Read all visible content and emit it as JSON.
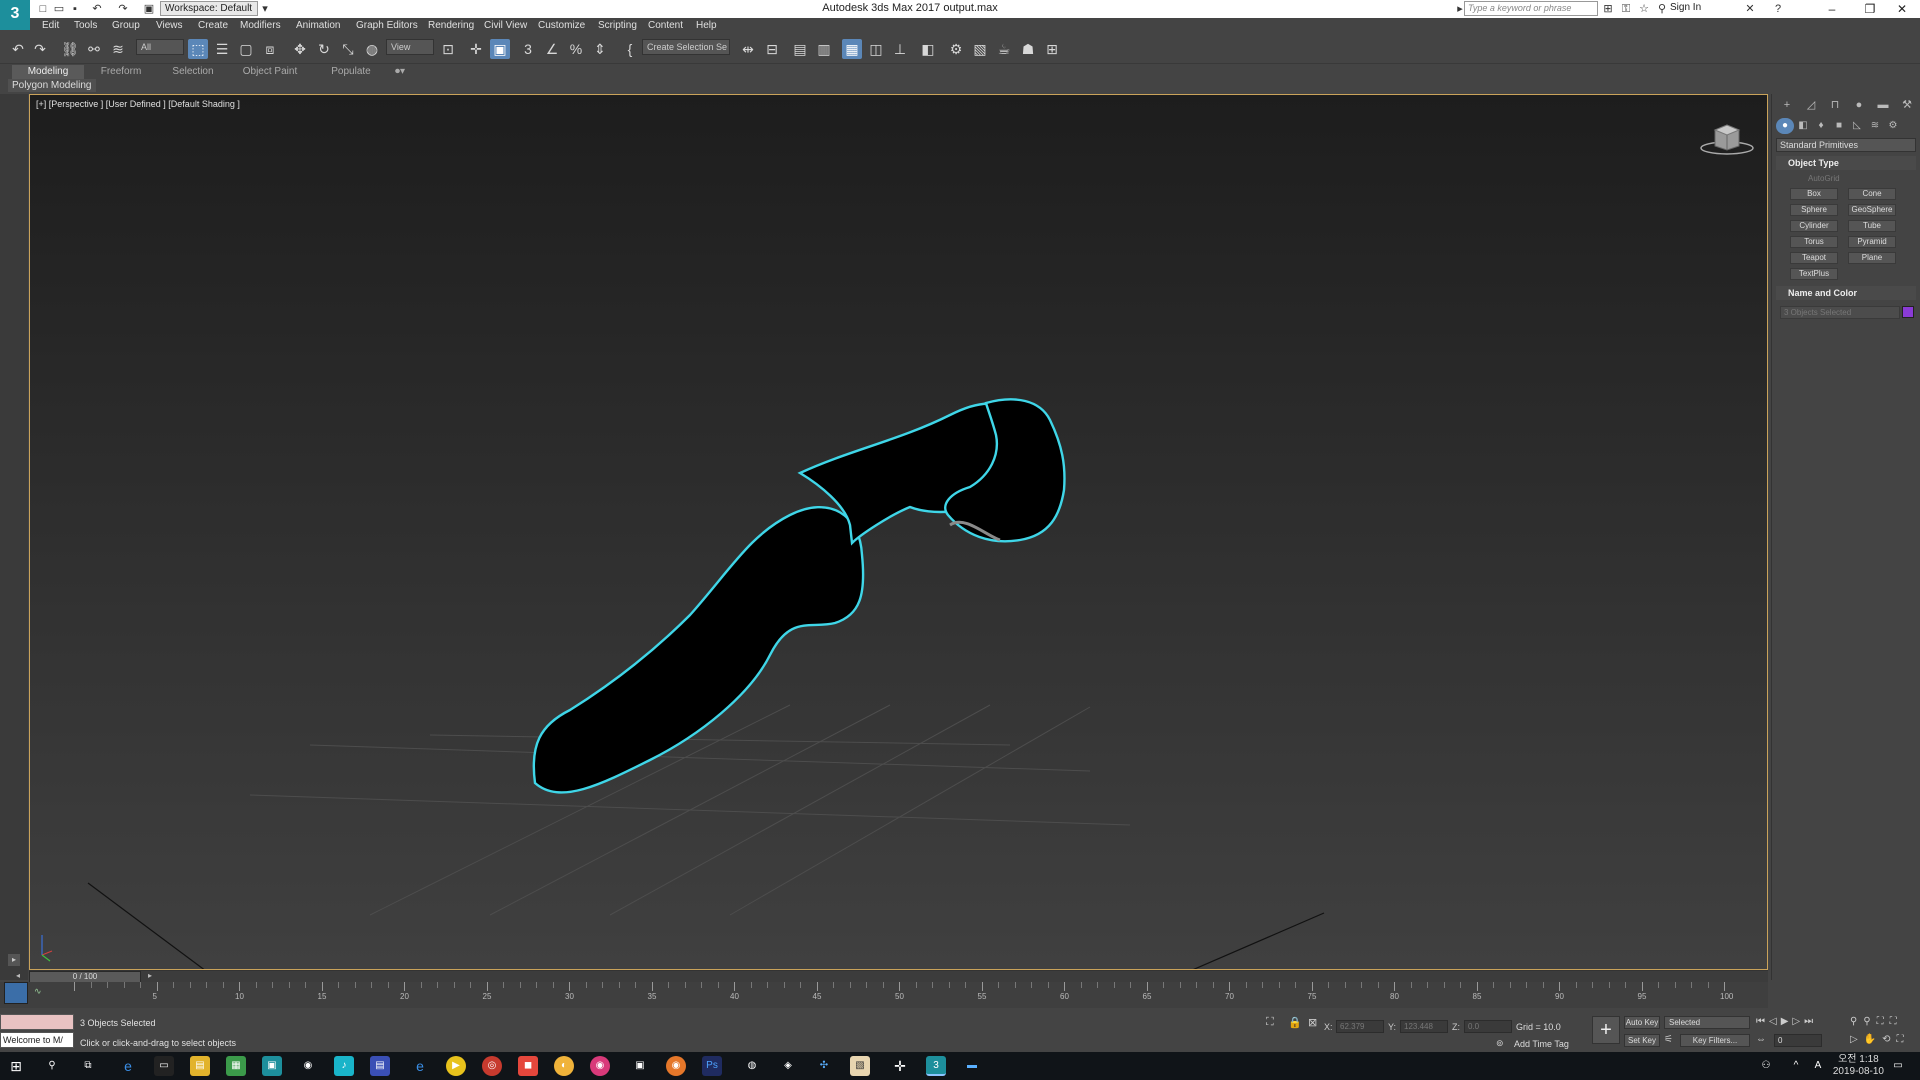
{
  "titlebar": {
    "app_logo": "3",
    "workspace": "Workspace: Default",
    "title": "Autodesk 3ds Max 2017     output.max",
    "search_placeholder": "Type a keyword or phrase",
    "signin": "Sign In"
  },
  "menu": [
    "Edit",
    "Tools",
    "Group",
    "Views",
    "Create",
    "Modifiers",
    "Animation",
    "Graph Editors",
    "Rendering",
    "Civil View",
    "Customize",
    "Scripting",
    "Content",
    "Help"
  ],
  "toolbar": {
    "selection_filter": "All",
    "ref_coord": "View",
    "selection_set": "Create Selection Se"
  },
  "ribbon": {
    "tabs": [
      "Modeling",
      "Freeform",
      "Selection",
      "Object Paint",
      "Populate"
    ],
    "active_tab": "Modeling",
    "sub_label": "Polygon Modeling"
  },
  "viewport": {
    "label": "[+] [Perspective ] [User Defined ] [Default Shading ]"
  },
  "command_panel": {
    "category": "Standard Primitives",
    "object_type_title": "Object Type",
    "autogrid": "AutoGrid",
    "buttons": [
      "Box",
      "Cone",
      "Sphere",
      "GeoSphere",
      "Cylinder",
      "Tube",
      "Torus",
      "Pyramid",
      "Teapot",
      "Plane",
      "TextPlus"
    ],
    "name_color_title": "Name and Color",
    "name_value": "3 Objects Selected",
    "swatch_color": "#8a3bd6"
  },
  "timeline": {
    "frame_readout": "0 / 100",
    "ticks": [
      0,
      5,
      10,
      15,
      20,
      25,
      30,
      35,
      40,
      45,
      50,
      55,
      60,
      65,
      70,
      75,
      80,
      85,
      90,
      95,
      100
    ]
  },
  "status": {
    "maxscript_text": "Welcome to M/",
    "line1": "3 Objects Selected",
    "line2": "Click or click-and-drag to select objects",
    "x_label": "X:",
    "x_value": "62.379",
    "y_label": "Y:",
    "y_value": "123.448",
    "z_label": "Z:",
    "z_value": "0.0",
    "grid": "Grid = 10.0",
    "add_time_tag": "Add Time Tag",
    "auto_key": "Auto Key",
    "selected": "Selected",
    "set_key": "Set Key",
    "key_filters": "Key Filters...",
    "frame_field": "0"
  },
  "taskbar": {
    "time": "오전 1:18",
    "date": "2019-08-10"
  },
  "colors": {
    "accent": "#5b87b8",
    "viewport_border": "#caa35a",
    "selection_outline": "#3fd6e8"
  }
}
